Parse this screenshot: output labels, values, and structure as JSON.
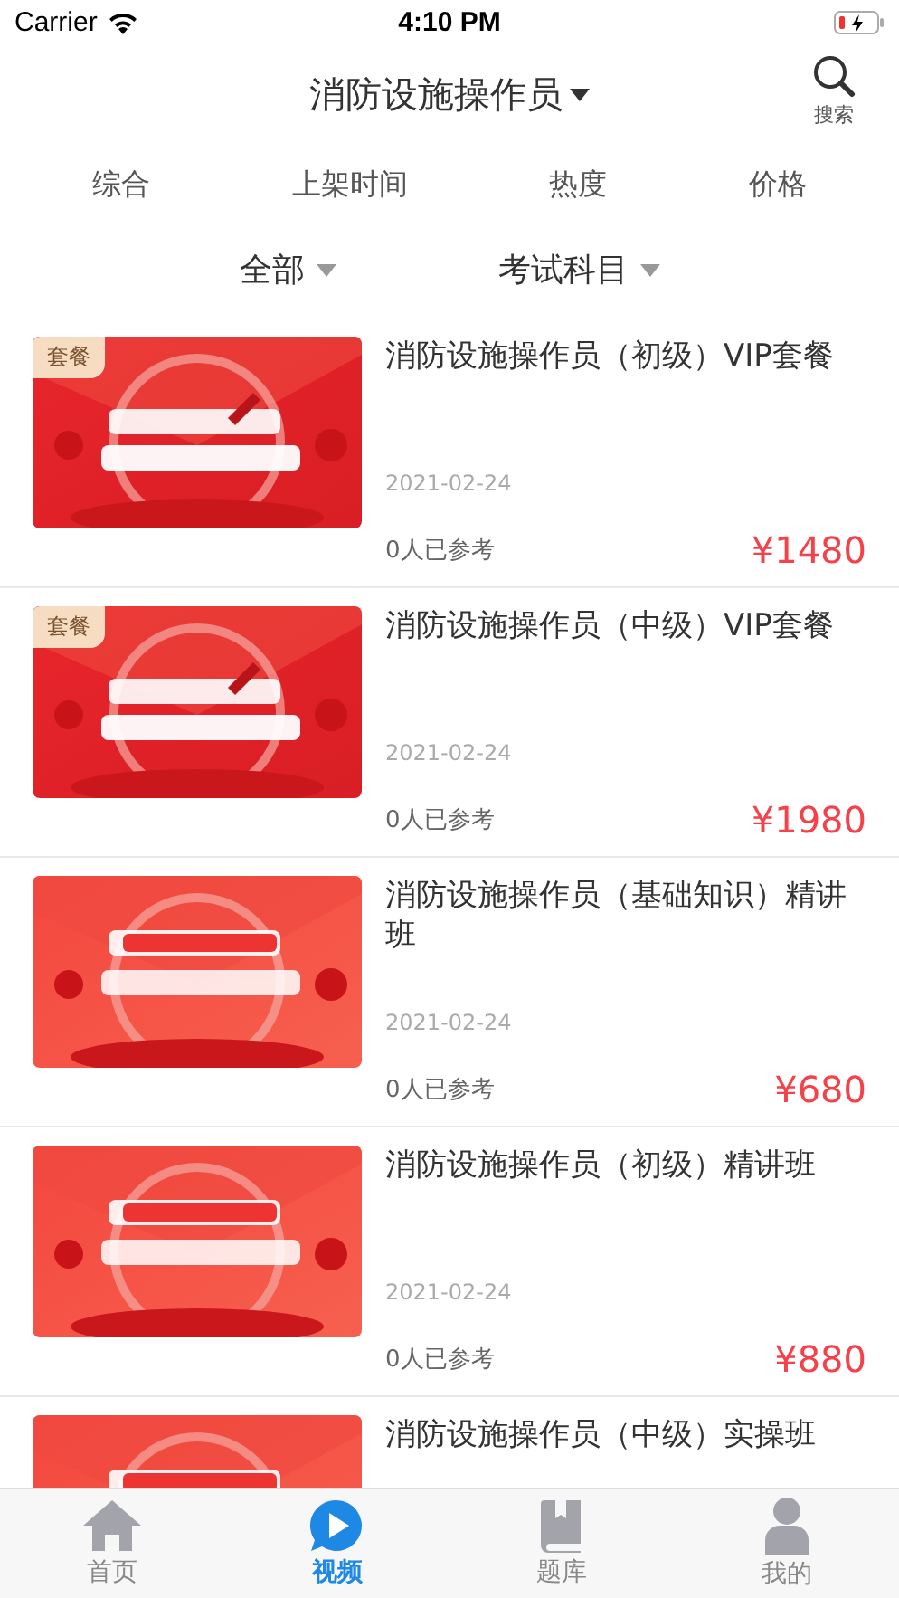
{
  "status_bar": {
    "carrier": "Carrier",
    "time": "4:10 PM"
  },
  "header": {
    "title": "消防设施操作员",
    "search_label": "搜索"
  },
  "sort_tabs": [
    {
      "label": "综合"
    },
    {
      "label": "上架时间"
    },
    {
      "label": "热度"
    },
    {
      "label": "价格"
    }
  ],
  "filters": [
    {
      "label": "全部"
    },
    {
      "label": "考试科目"
    }
  ],
  "courses": [
    {
      "badge": "套餐",
      "title": "消防设施操作员（初级）VIP套餐",
      "date": "2021-02-24",
      "takers": "0人已参考",
      "price": "¥1480"
    },
    {
      "badge": "套餐",
      "title": "消防设施操作员（中级）VIP套餐",
      "date": "2021-02-24",
      "takers": "0人已参考",
      "price": "¥1980"
    },
    {
      "title": "消防设施操作员（基础知识）精讲班",
      "date": "2021-02-24",
      "takers": "0人已参考",
      "price": "¥680"
    },
    {
      "title": "消防设施操作员（初级）精讲班",
      "date": "2021-02-24",
      "takers": "0人已参考",
      "price": "¥880"
    },
    {
      "title": "消防设施操作员（中级）实操班"
    }
  ],
  "tab_bar": [
    {
      "label": "首页",
      "selected": false
    },
    {
      "label": "视频",
      "selected": true
    },
    {
      "label": "题库",
      "selected": false
    },
    {
      "label": "我的",
      "selected": false
    }
  ]
}
